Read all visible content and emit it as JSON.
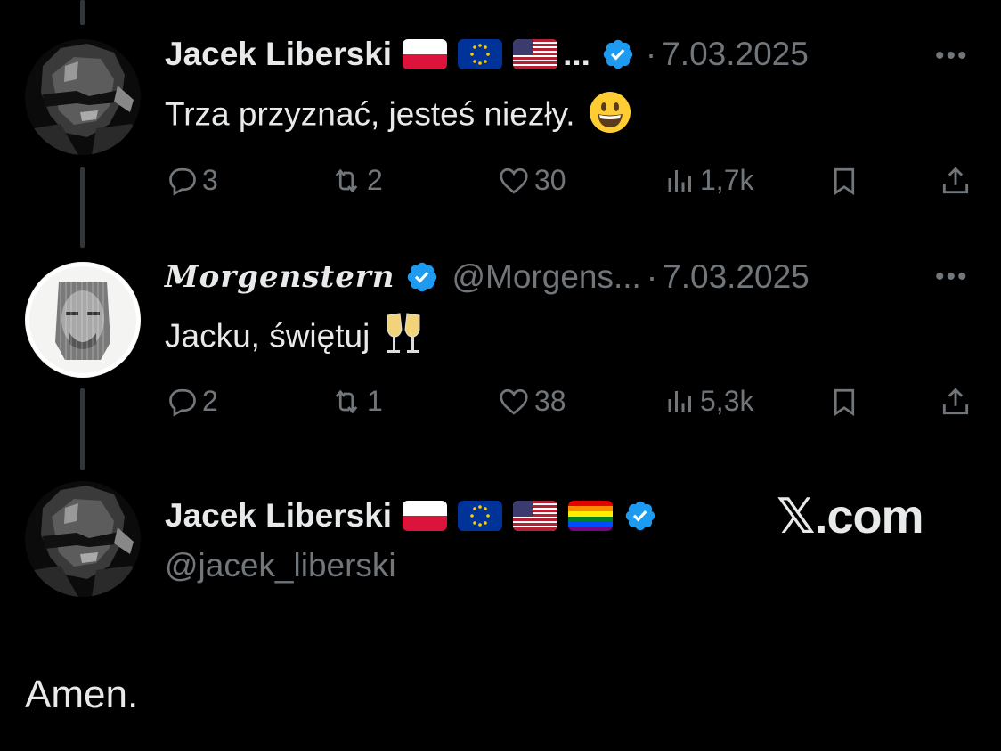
{
  "tweets": [
    {
      "author": "Jacek Liberski",
      "flags": [
        "poland-flag",
        "eu-flag",
        "usa-flag"
      ],
      "truncation": "...",
      "separator": "·",
      "date": "7.03.2025",
      "text": "Trza przyznać, jesteś niezły.",
      "emoji": "grinning-face",
      "stats": {
        "replies": "3",
        "reposts": "2",
        "likes": "30",
        "views": "1,7k"
      }
    },
    {
      "author": "Morgenstern",
      "handle": "@Morgens...",
      "separator": "·",
      "date": "7.03.2025",
      "text": "Jacku, świętuj",
      "emoji": "clinking-glasses",
      "stats": {
        "replies": "2",
        "reposts": "1",
        "likes": "38",
        "views": "5,3k"
      }
    }
  ],
  "main_post": {
    "author": "Jacek Liberski",
    "flags": [
      "poland-flag",
      "eu-flag",
      "usa-flag",
      "rainbow-flag"
    ],
    "handle": "@jacek_liberski",
    "text": "Amen."
  },
  "watermark": {
    "text": "𝕏.com"
  },
  "more_label": "•••",
  "colors": {
    "background": "#000000",
    "text": "#e7e9ea",
    "muted": "#71767b",
    "verified": "#1d9bf0",
    "thread_line": "#333639"
  }
}
